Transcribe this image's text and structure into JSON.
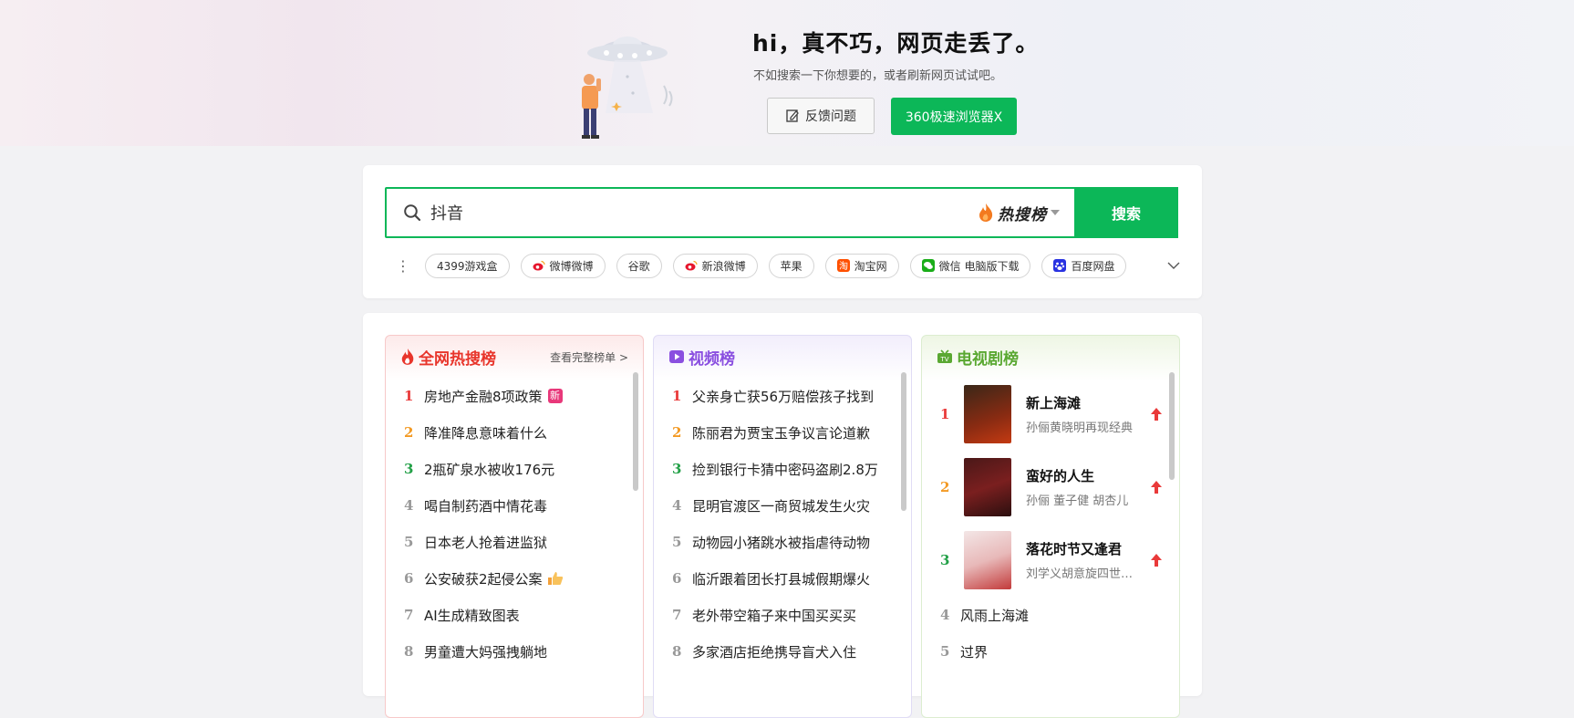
{
  "error": {
    "title": "hi，真不巧，网页走丢了。",
    "subtitle": "不如搜索一下你想要的，或者刷新网页试试吧。",
    "feedback_label": "反馈问题",
    "browser_label": "360极速浏览器X"
  },
  "search": {
    "value": "抖音",
    "hot_label": "热搜榜",
    "button_label": "搜索"
  },
  "quick_links": [
    {
      "label": "4399游戏盒",
      "icon": ""
    },
    {
      "label": "微博微博",
      "icon": "weibo-icon"
    },
    {
      "label": "谷歌",
      "icon": ""
    },
    {
      "label": "新浪微博",
      "icon": "weibo-icon"
    },
    {
      "label": "苹果",
      "icon": ""
    },
    {
      "label": "淘宝网",
      "icon": "taobao-icon"
    },
    {
      "label": "微信 电脑版下载",
      "icon": "wechat-icon"
    },
    {
      "label": "百度网盘",
      "icon": "baidu-icon"
    }
  ],
  "hot_list": {
    "title": "全网热搜榜",
    "more_label": "查看完整榜单 >",
    "items": [
      {
        "rank": "1",
        "text": "房地产金融8项政策",
        "badge": "新"
      },
      {
        "rank": "2",
        "text": "降准降息意味着什么"
      },
      {
        "rank": "3",
        "text": "2瓶矿泉水被收176元"
      },
      {
        "rank": "4",
        "text": "喝自制药酒中情花毒"
      },
      {
        "rank": "5",
        "text": "日本老人抢着进监狱"
      },
      {
        "rank": "6",
        "text": "公安破获2起侵公案"
      },
      {
        "rank": "7",
        "text": "AI生成精致图表"
      },
      {
        "rank": "8",
        "text": "男童遭大妈强拽躺地"
      }
    ]
  },
  "video_list": {
    "title": "视频榜",
    "items": [
      {
        "rank": "1",
        "text": "父亲身亡获56万赔偿孩子找到"
      },
      {
        "rank": "2",
        "text": "陈丽君为贾宝玉争议言论道歉"
      },
      {
        "rank": "3",
        "text": "捡到银行卡猜中密码盗刷2.8万"
      },
      {
        "rank": "4",
        "text": "昆明官渡区一商贸城发生火灾"
      },
      {
        "rank": "5",
        "text": "动物园小猪跳水被指虐待动物"
      },
      {
        "rank": "6",
        "text": "临沂跟着团长打县城假期爆火"
      },
      {
        "rank": "7",
        "text": "老外带空箱子来中国买买买"
      },
      {
        "rank": "8",
        "text": "多家酒店拒绝携导盲犬入住"
      }
    ]
  },
  "tv_list": {
    "title": "电视剧榜",
    "featured": [
      {
        "rank": "1",
        "name": "新上海滩",
        "cast": "孙俪黄晓明再现经典"
      },
      {
        "rank": "2",
        "name": "蛮好的人生",
        "cast": "孙俪 董子健 胡杏儿"
      },
      {
        "rank": "3",
        "name": "落花时节又逢君",
        "cast": "刘学义胡意旋四世…"
      }
    ],
    "items": [
      {
        "rank": "4",
        "text": "风雨上海滩"
      },
      {
        "rank": "5",
        "text": "过界"
      }
    ]
  },
  "colors": {
    "accent": "#0cb758",
    "rank1": "#e93a3a",
    "rank2": "#f39a24",
    "rank3": "#22a047",
    "hot_title": "#e8352b",
    "video_title": "#8a4fe0",
    "tv_title": "#5aa832"
  }
}
